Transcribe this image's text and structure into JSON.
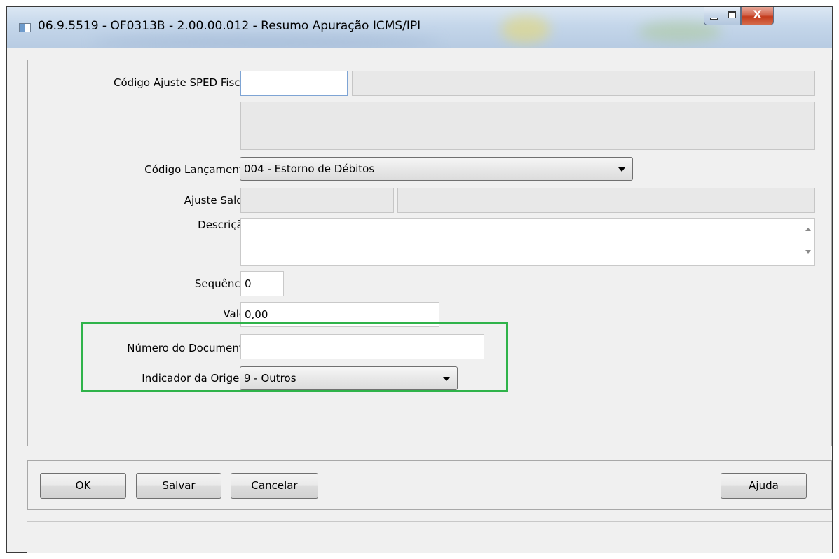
{
  "window": {
    "title": "06.9.5519 - OF0313B - 2.00.00.012 - Resumo Apuração ICMS/IPI",
    "minimize_glyph": "",
    "maximize_glyph": "",
    "close_glyph": "X"
  },
  "form": {
    "codigo_ajuste_label": "Código Ajuste SPED Fiscal:",
    "codigo_ajuste_value": "",
    "codigo_ajuste_desc": "",
    "codigo_ajuste_memo": "",
    "codigo_lancamento_label": "Código Lançamento:",
    "codigo_lancamento_value": "004 - Estorno de Débitos",
    "ajuste_saldo_label": "Ajuste Saldo:",
    "ajuste_saldo_code": "",
    "ajuste_saldo_desc": "",
    "descricao_label": "Descrição:",
    "descricao_value": "",
    "sequencia_label": "Sequência:",
    "sequencia_value": "0",
    "valor_label": "Valor:",
    "valor_value": "0,00",
    "numero_documento_label": "Número do Documento:",
    "numero_documento_value": "",
    "indicador_origem_label": "Indicador da Origem:",
    "indicador_origem_value": "9 - Outros"
  },
  "buttons": {
    "ok_mnemonic": "O",
    "ok_rest": "K",
    "salvar_mnemonic": "S",
    "salvar_rest": "alvar",
    "cancelar_mnemonic": "C",
    "cancelar_rest": "ancelar",
    "ajuda_pre": "A",
    "ajuda_mnemonic": "j",
    "ajuda_rest": "uda"
  },
  "colors": {
    "highlight_border": "#2fb34a",
    "close_button": "#c43c1c",
    "titlebar": "#c4d6ea"
  },
  "icons": [
    "window-app-icon",
    "minimize-icon",
    "maximize-icon",
    "close-icon",
    "chevron-down-icon",
    "scroll-up-icon",
    "scroll-down-icon"
  ]
}
